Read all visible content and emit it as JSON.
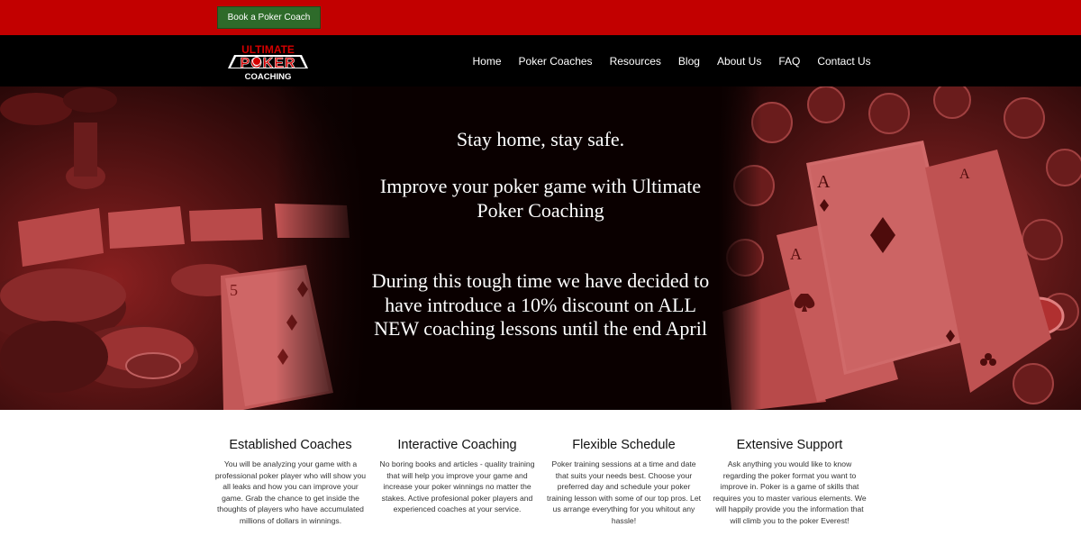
{
  "topbar": {
    "book_button": "Book a Poker Coach"
  },
  "logo": {
    "line1": "ULTIMATE",
    "line2": "POKER",
    "line3": "COACHING"
  },
  "nav": {
    "items": [
      "Home",
      "Poker Coaches",
      "Resources",
      "Blog",
      "About Us",
      "FAQ",
      "Contact Us"
    ]
  },
  "hero": {
    "line1": "Stay home, stay safe.",
    "line2": "Improve your poker game with Ultimate Poker Coaching",
    "line3": "During this tough time we have decided to have introduce a 10% discount on ALL NEW coaching lessons until the end April"
  },
  "features": [
    {
      "title": "Established Coaches",
      "text": "You will be analyzing your game with a professional poker player who will show you all leaks and how you can improve your game. Grab the chance to get inside the thoughts of players who have accumulated millions of dollars in winnings."
    },
    {
      "title": "Interactive Coaching",
      "text": "No boring books and articles - quality training that will help you improve your game and increase your poker winnings no matter the stakes. Active profesional poker players and experienced coaches at your service."
    },
    {
      "title": "Flexible Schedule",
      "text": "Poker training sessions at a time and date that suits your needs best. Choose your preferred day and schedule your poker training lesson with some of our top pros. Let us arrange everything for you whitout any hassle!"
    },
    {
      "title": "Extensive Support",
      "text": "Ask anything you would like to know regarding the poker format you want to improve in. Poker is a game of skills that requires you to master various elements. We will happily provide you the information that will climb you to the poker Everest!"
    }
  ],
  "colors": {
    "topbar": "#c20000",
    "button": "#2e6b2a",
    "navbar": "#000000",
    "hero_tint": "#b02a2a"
  }
}
